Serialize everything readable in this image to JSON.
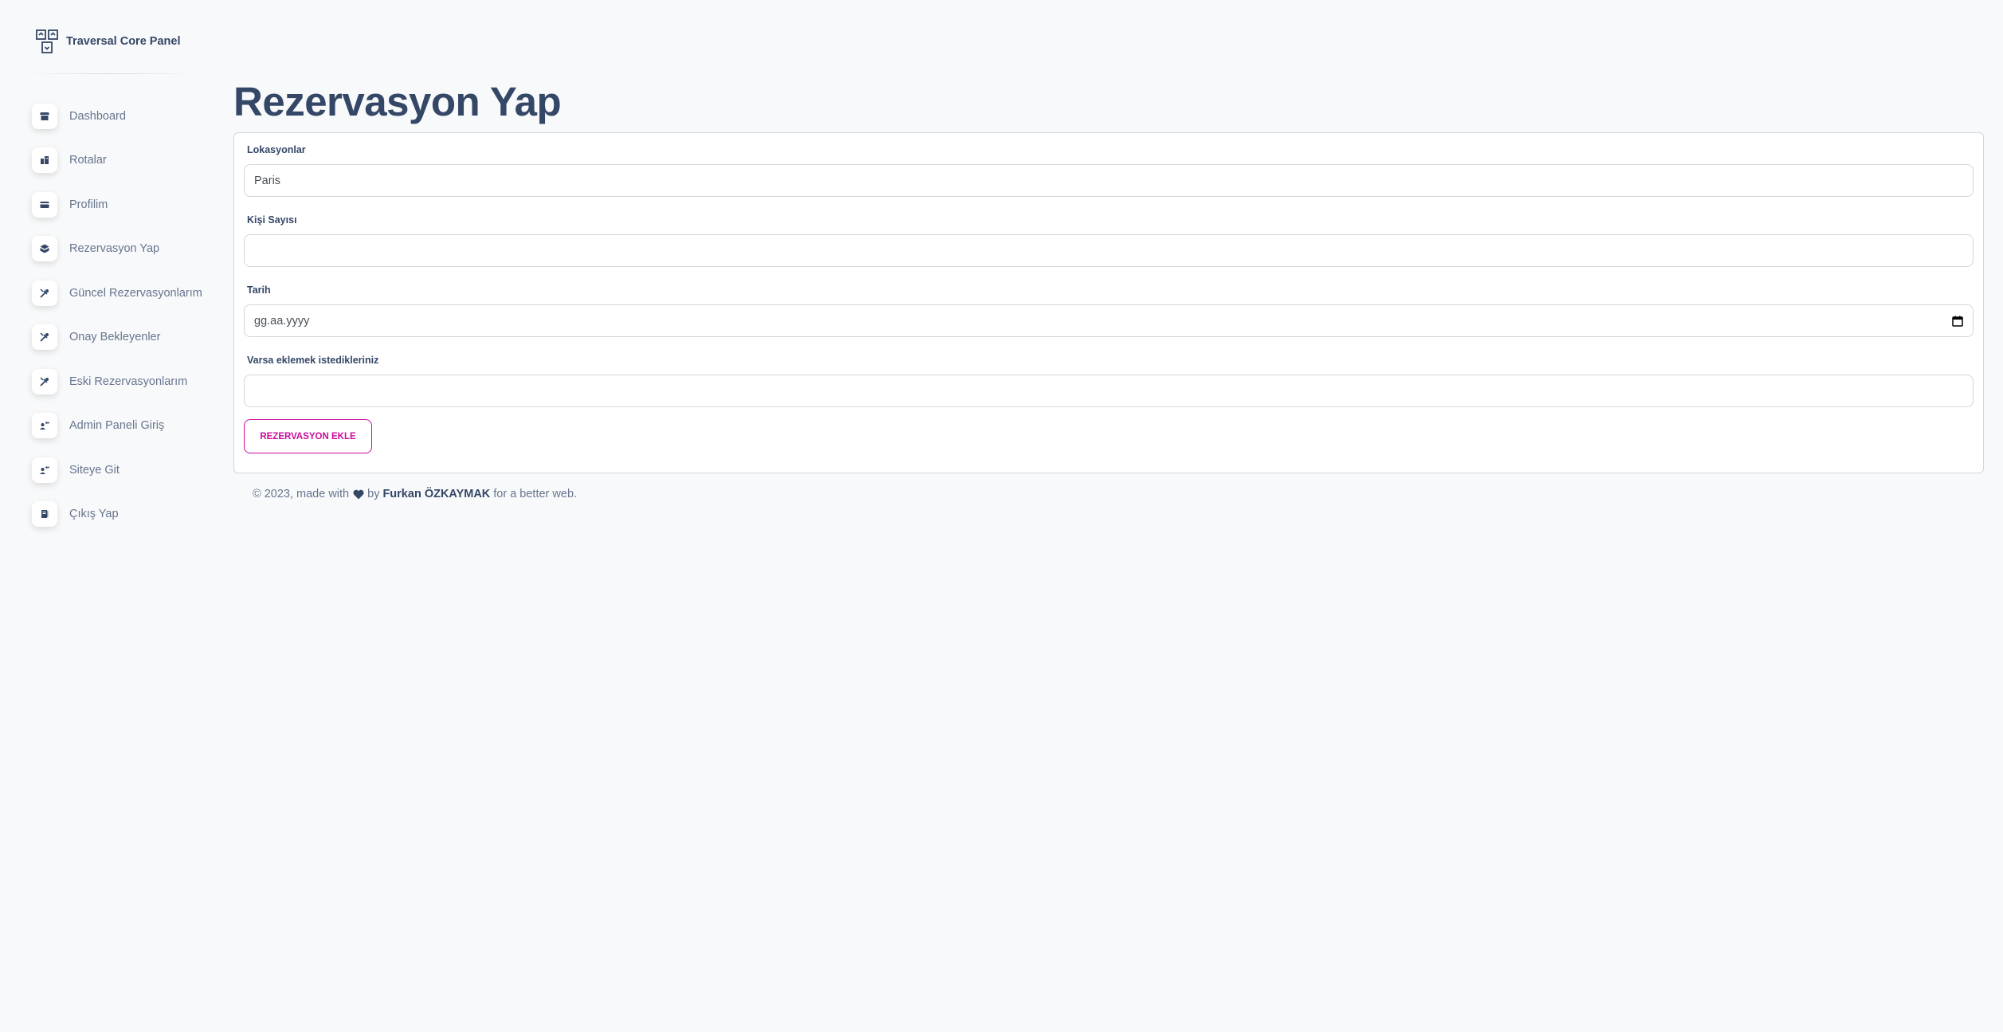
{
  "brand": {
    "name": "Traversal Core Panel",
    "logo_icon": "box-logo-icon"
  },
  "sidebar": {
    "items": [
      {
        "label": "Dashboard",
        "icon": "shop-icon"
      },
      {
        "label": "Rotalar",
        "icon": "office-icon"
      },
      {
        "label": "Profilim",
        "icon": "credit-card-icon"
      },
      {
        "label": "Rezervasyon Yap",
        "icon": "box-3d-icon"
      },
      {
        "label": "Güncel Rezervasyonlarım",
        "icon": "settings-tools-icon"
      },
      {
        "label": "Onay Bekleyenler",
        "icon": "settings-tools-icon"
      },
      {
        "label": "Eski Rezervasyonlarım",
        "icon": "settings-tools-icon"
      },
      {
        "label": "Admin Paneli Giriş",
        "icon": "customer-support-icon"
      },
      {
        "label": "Siteye Git",
        "icon": "customer-support-icon"
      },
      {
        "label": "Çıkış Yap",
        "icon": "document-icon"
      }
    ]
  },
  "main": {
    "title": "Rezervasyon Yap",
    "form": {
      "location_label": "Lokasyonlar",
      "location_value": "Paris",
      "people_label": "Kişi Sayısı",
      "people_value": "",
      "date_label": "Tarih",
      "date_placeholder": "gg.aa.yyyy",
      "notes_label": "Varsa eklemek istedikleriniz",
      "notes_value": "",
      "submit_label": "REZERVASYON EKLE"
    }
  },
  "footer": {
    "prefix": "© 2023, made with",
    "by": "by",
    "author": "Furkan ÖZKAYMAK",
    "suffix": "for a better web."
  },
  "colors": {
    "accent": "#cb0c9f",
    "text_dark": "#344767",
    "text_muted": "#67748e",
    "background": "#f8f9fa"
  }
}
